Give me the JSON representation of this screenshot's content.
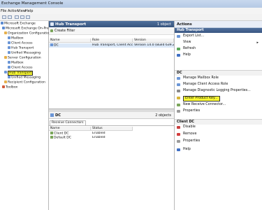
{
  "window": {
    "title": "Exchange Management Console"
  },
  "menu": [
    "File",
    "Action",
    "View",
    "Help"
  ],
  "tree": [
    {
      "label": "Microsoft Exchange",
      "color": "#5b8ad0"
    },
    {
      "label": "Microsoft Exchange On-Premises (i...",
      "color": "#5b8ad0"
    },
    {
      "label": "Organization Configuration",
      "color": "#e6b04a"
    },
    {
      "label": "Mailbox",
      "color": "#6b96d6"
    },
    {
      "label": "Client Access",
      "color": "#6b96d6"
    },
    {
      "label": "Hub Transport",
      "color": "#6b96d6"
    },
    {
      "label": "Unified Messaging",
      "color": "#6b96d6"
    },
    {
      "label": "Server Configuration",
      "color": "#e6b04a"
    },
    {
      "label": "Mailbox",
      "color": "#6b96d6"
    },
    {
      "label": "Client Access",
      "color": "#6b96d6"
    },
    {
      "label": "Hub Transport",
      "color": "#6b96d6",
      "selected": true
    },
    {
      "label": "Unified Messaging",
      "color": "#6b96d6"
    },
    {
      "label": "Recipient Configuration",
      "color": "#e6b04a"
    },
    {
      "label": "Toolbox",
      "color": "#d25b3a"
    }
  ],
  "main": {
    "title": "Hub Transport",
    "count": "1 object",
    "filter_label": "Create Filter",
    "columns": [
      "Name",
      "Role",
      "Version"
    ],
    "rows": [
      {
        "name": "DC",
        "role": "Hub Transport, Client Acc...",
        "version": "Version 14.0 (Build 639.21)"
      }
    ]
  },
  "detail": {
    "title": "DC",
    "count": "2 objects",
    "tab": "Receive Connectors",
    "columns": [
      "Name",
      "Status"
    ],
    "rows": [
      {
        "name": "Client DC",
        "status": "Enabled"
      },
      {
        "name": "Default DC",
        "status": "Enabled"
      }
    ]
  },
  "actions": {
    "title": "Actions",
    "hub": {
      "header": "Hub Transport",
      "items": [
        "Export List...",
        "View",
        "Refresh",
        "Help"
      ]
    },
    "dc": {
      "header": "DC",
      "items": [
        "Manage Mailbox Role",
        "Manage Client Access Role",
        "Manage Diagnostic Logging Properties...",
        "Enter Product Key...",
        "New Receive Connector...",
        "Properties"
      ]
    },
    "client": {
      "header": "Client DC",
      "items": [
        "Disable",
        "Remove",
        "Properties",
        "Help"
      ]
    }
  }
}
